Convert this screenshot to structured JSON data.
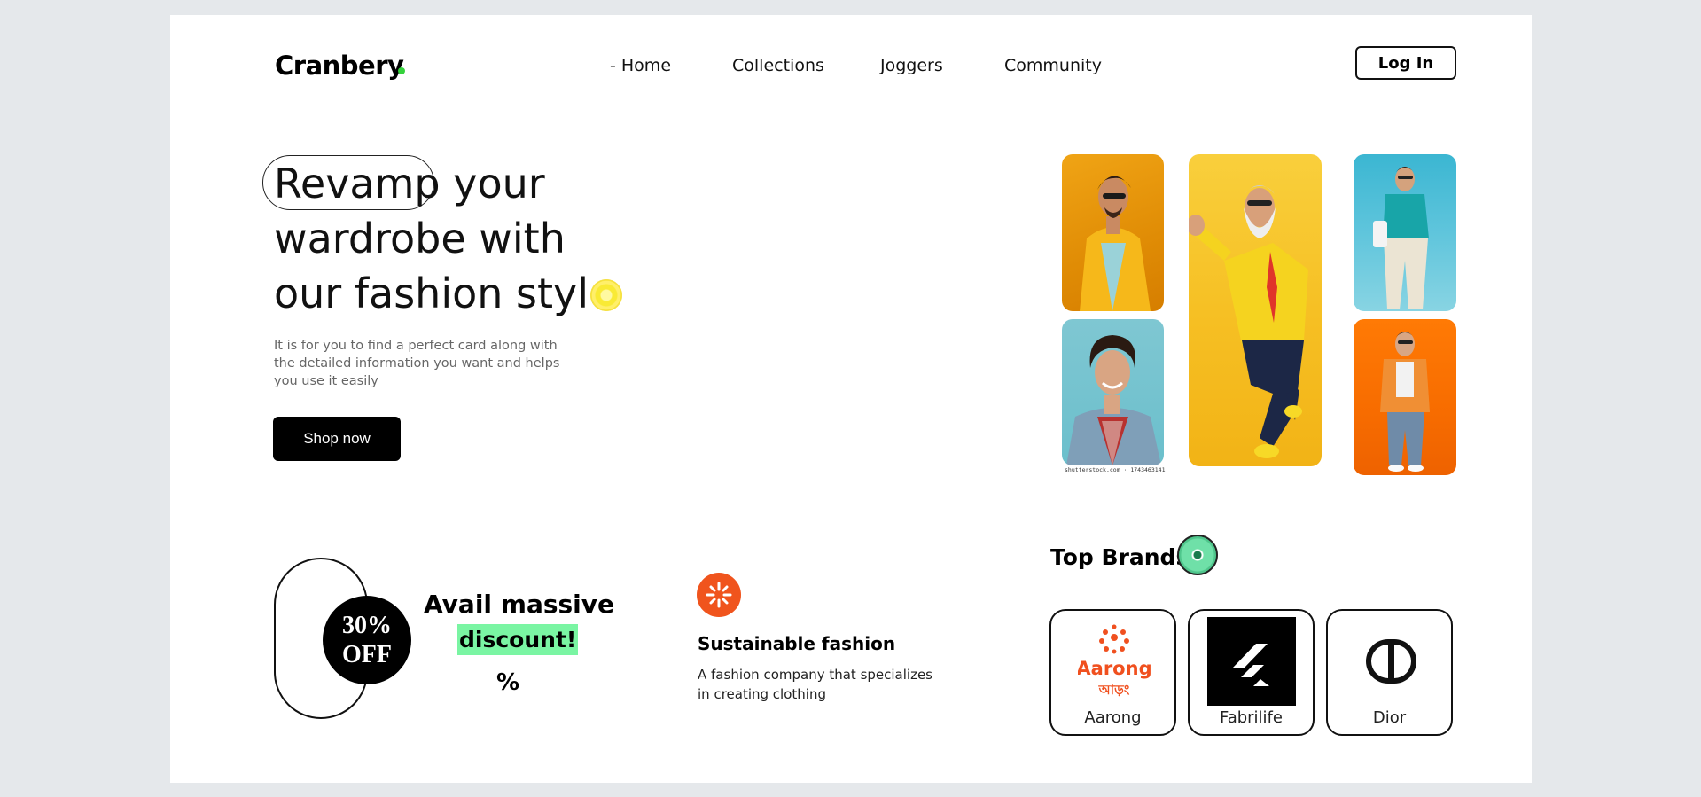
{
  "nav": {
    "logo": "Cranbery",
    "links": [
      "- Home",
      "Collections",
      "Joggers",
      "Community"
    ],
    "login_label": "Log In"
  },
  "hero": {
    "highlight_word": "Revamp",
    "line1_rest": "your",
    "line2": "wardrobe with",
    "line3": "our fashion style",
    "description": "It is for you to find a perfect card along with the detailed information you want and helps you use it easily",
    "cta_label": "Shop now",
    "photo_watermark": "shutterstock.com · 1743463141"
  },
  "offer": {
    "badge_line1": "30%",
    "badge_line2": "OFF",
    "title": "Avail massive",
    "highlight": "discount!",
    "symbol": "%",
    "highlight_color": "#7af5a3"
  },
  "feature": {
    "title": "Sustainable fashion",
    "description": "A fashion company that specializes in creating clothing",
    "icon_color": "#f0541d"
  },
  "brands": {
    "title": "Top Brands",
    "items": [
      {
        "name": "Aarong",
        "logo_text": "Aarong",
        "logo_subtext": "আড়ং"
      },
      {
        "name": "Fabrilife"
      },
      {
        "name": "Dior"
      }
    ]
  },
  "colors": {
    "accent_dot": "#35d23c",
    "orange": "#f0541d",
    "aarong_orange": "#f0501f"
  }
}
